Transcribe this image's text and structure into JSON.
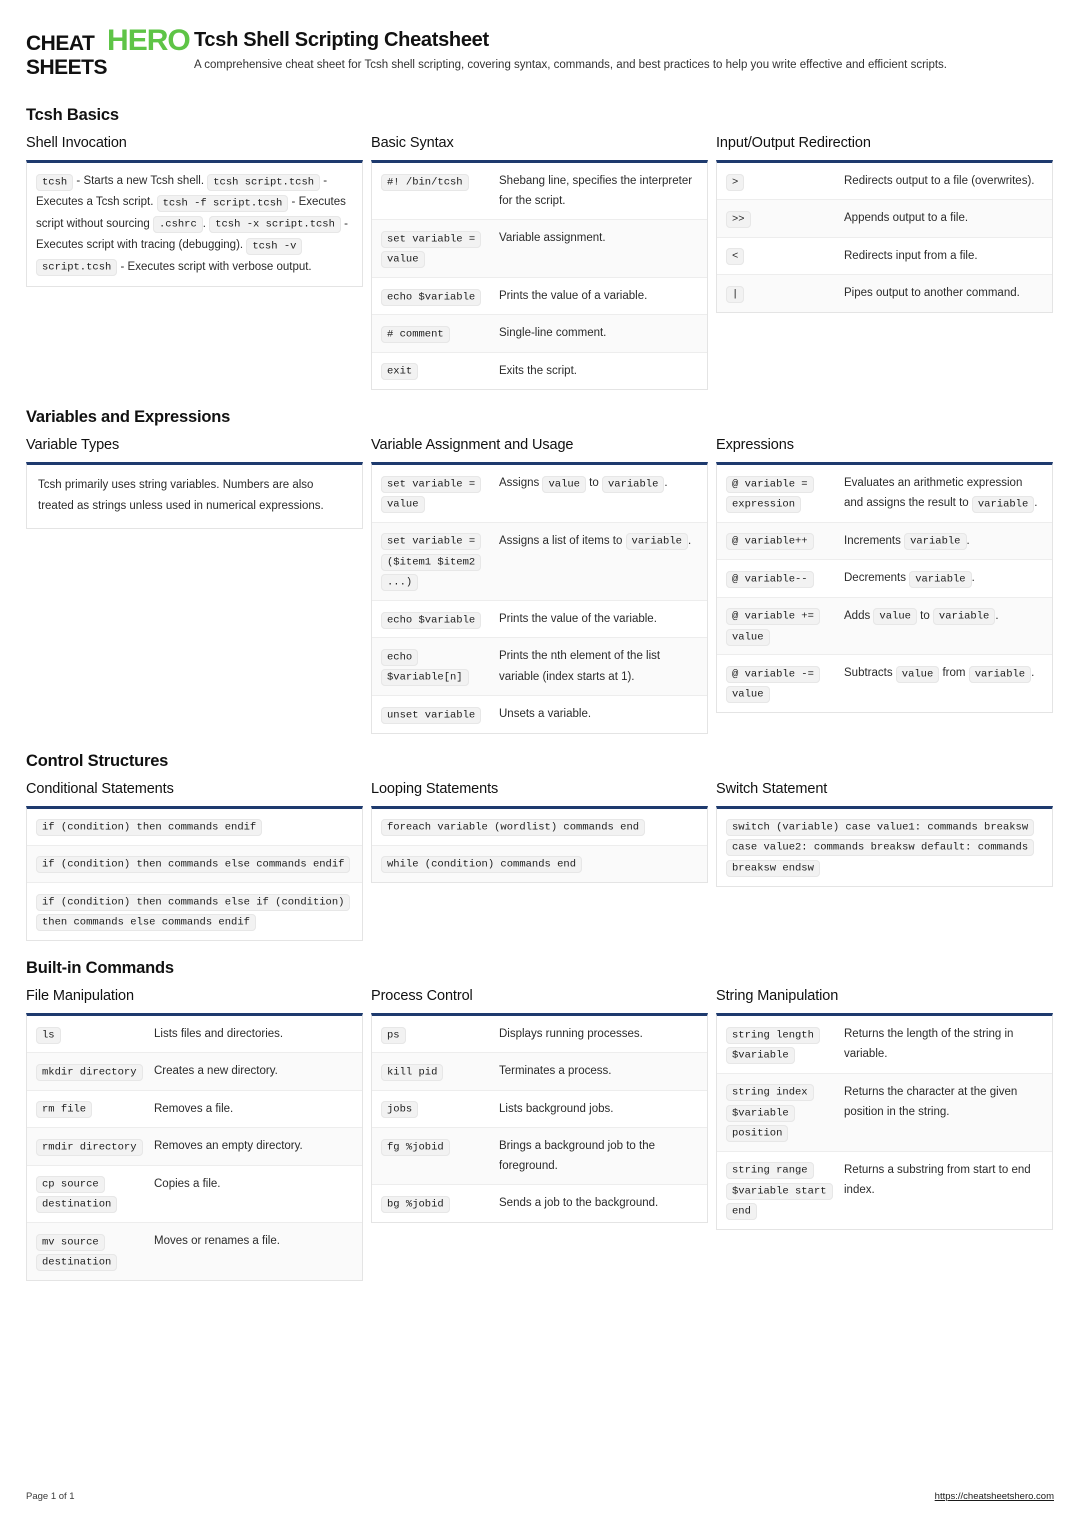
{
  "brand": {
    "logo_line1": "CHEAT",
    "logo_line2": "SHEETS",
    "logo_accent": "HERO",
    "accent_color": "#5ec446"
  },
  "header": {
    "title": "Tcsh Shell Scripting Cheatsheet",
    "subtitle": "A comprehensive cheat sheet for Tcsh shell scripting, covering syntax, commands, and best practices to help you write effective and efficient scripts."
  },
  "theme": {
    "card_border_top": "#1e3a6e",
    "code_bg": "#f2f2f2",
    "row_alt_bg": "#fafafa"
  },
  "sections": [
    {
      "title": "Tcsh Basics",
      "cards": [
        {
          "title": "Shell Invocation",
          "type": "free",
          "lines": [
            [
              {
                "c": "tcsh"
              },
              {
                "t": " - Starts a new Tcsh shell."
              }
            ],
            [
              {
                "c": "tcsh script.tcsh"
              },
              {
                "t": " - Executes a Tcsh script."
              }
            ],
            [
              {
                "c": "tcsh -f script.tcsh"
              },
              {
                "t": " - Executes script without sourcing "
              },
              {
                "c": ".cshrc"
              },
              {
                "t": "."
              }
            ],
            [
              {
                "c": "tcsh -x script.tcsh"
              },
              {
                "t": " - Executes script with tracing (debugging)."
              }
            ],
            [
              {
                "c": "tcsh -v script.tcsh"
              },
              {
                "t": " - Executes script with verbose output."
              }
            ]
          ]
        },
        {
          "title": "Basic Syntax",
          "type": "pairs",
          "rows": [
            {
              "term": "#! /bin/tcsh",
              "desc": "Shebang line, specifies the interpreter for the script."
            },
            {
              "term": "set variable = value",
              "desc": "Variable assignment."
            },
            {
              "term": "echo $variable",
              "desc": "Prints the value of a variable."
            },
            {
              "term": "# comment",
              "desc": "Single-line comment."
            },
            {
              "term": "exit",
              "desc": "Exits the script."
            }
          ]
        },
        {
          "title": "Input/Output Redirection",
          "type": "pairs",
          "rows": [
            {
              "term": ">",
              "desc": "Redirects output to a file (overwrites)."
            },
            {
              "term": ">>",
              "desc": "Appends output to a file."
            },
            {
              "term": "<",
              "desc": "Redirects input from a file."
            },
            {
              "term": "|",
              "desc": "Pipes output to another command."
            }
          ]
        }
      ]
    },
    {
      "title": "Variables and Expressions",
      "cards": [
        {
          "title": "Variable Types",
          "type": "note",
          "note": "Tcsh primarily uses string variables. Numbers are also treated as strings unless used in numerical expressions."
        },
        {
          "title": "Variable Assignment and Usage",
          "type": "rich",
          "rows": [
            {
              "term": "set variable = value",
              "desc": [
                {
                  "t": "Assigns "
                },
                {
                  "c": "value"
                },
                {
                  "t": " to "
                },
                {
                  "c": "variable"
                },
                {
                  "t": "."
                }
              ]
            },
            {
              "term": "set variable = ($item1 $item2 ...)",
              "desc": [
                {
                  "t": "Assigns a list of items to "
                },
                {
                  "c": "variable"
                },
                {
                  "t": "."
                }
              ]
            },
            {
              "term": "echo $variable",
              "desc": [
                {
                  "t": "Prints the value of the variable."
                }
              ]
            },
            {
              "term": "echo $variable[n]",
              "desc": [
                {
                  "t": "Prints the nth element of the list variable (index starts at 1)."
                }
              ]
            },
            {
              "term": "unset variable",
              "desc": [
                {
                  "t": "Unsets a variable."
                }
              ]
            }
          ]
        },
        {
          "title": "Expressions",
          "type": "rich",
          "rows": [
            {
              "term": "@ variable = expression",
              "desc": [
                {
                  "t": "Evaluates an arithmetic expression and assigns the result to "
                },
                {
                  "c": "variable"
                },
                {
                  "t": "."
                }
              ]
            },
            {
              "term": "@ variable++",
              "desc": [
                {
                  "t": "Increments "
                },
                {
                  "c": "variable"
                },
                {
                  "t": "."
                }
              ]
            },
            {
              "term": "@ variable--",
              "desc": [
                {
                  "t": "Decrements "
                },
                {
                  "c": "variable"
                },
                {
                  "t": "."
                }
              ]
            },
            {
              "term": "@ variable += value",
              "desc": [
                {
                  "t": "Adds "
                },
                {
                  "c": "value"
                },
                {
                  "t": " to "
                },
                {
                  "c": "variable"
                },
                {
                  "t": "."
                }
              ]
            },
            {
              "term": "@ variable -= value",
              "desc": [
                {
                  "t": "Subtracts "
                },
                {
                  "c": "value"
                },
                {
                  "t": " from "
                },
                {
                  "c": "variable"
                },
                {
                  "t": "."
                }
              ]
            }
          ]
        }
      ]
    },
    {
      "title": "Control Structures",
      "cards": [
        {
          "title": "Conditional Statements",
          "type": "code-list",
          "items": [
            "if (condition) then commands endif",
            "if (condition) then commands else commands endif",
            "if (condition) then commands else if (condition) then commands else commands endif"
          ]
        },
        {
          "title": "Looping Statements",
          "type": "code-list",
          "items": [
            "foreach variable (wordlist) commands end",
            "while (condition) commands end"
          ]
        },
        {
          "title": "Switch Statement",
          "type": "code-list",
          "items": [
            "switch (variable) case value1: commands breaksw case value2: commands breaksw default: commands breaksw endsw"
          ]
        }
      ]
    },
    {
      "title": "Built-in Commands",
      "cards": [
        {
          "title": "File Manipulation",
          "type": "pairs",
          "rows": [
            {
              "term": "ls",
              "desc": "Lists files and directories."
            },
            {
              "term": "mkdir directory",
              "desc": "Creates a new directory."
            },
            {
              "term": "rm file",
              "desc": "Removes a file."
            },
            {
              "term": "rmdir directory",
              "desc": "Removes an empty directory."
            },
            {
              "term": "cp source destination",
              "desc": "Copies a file."
            },
            {
              "term": "mv source destination",
              "desc": "Moves or renames a file."
            }
          ]
        },
        {
          "title": "Process Control",
          "type": "pairs",
          "rows": [
            {
              "term": "ps",
              "desc": "Displays running processes."
            },
            {
              "term": "kill pid",
              "desc": "Terminates a process."
            },
            {
              "term": "jobs",
              "desc": "Lists background jobs."
            },
            {
              "term": "fg %jobid",
              "desc": "Brings a background job to the foreground."
            },
            {
              "term": "bg %jobid",
              "desc": "Sends a job to the background."
            }
          ]
        },
        {
          "title": "String Manipulation",
          "type": "pairs",
          "rows": [
            {
              "term": "string length $variable",
              "desc": "Returns the length of the string in variable."
            },
            {
              "term": "string index $variable position",
              "desc": "Returns the character at the given position in the string."
            },
            {
              "term": "string range $variable start end",
              "desc": "Returns a substring from start to end index."
            }
          ]
        }
      ]
    }
  ],
  "footer": {
    "page_label": "Page 1 of 1",
    "url": "https://cheatsheetshero.com"
  }
}
